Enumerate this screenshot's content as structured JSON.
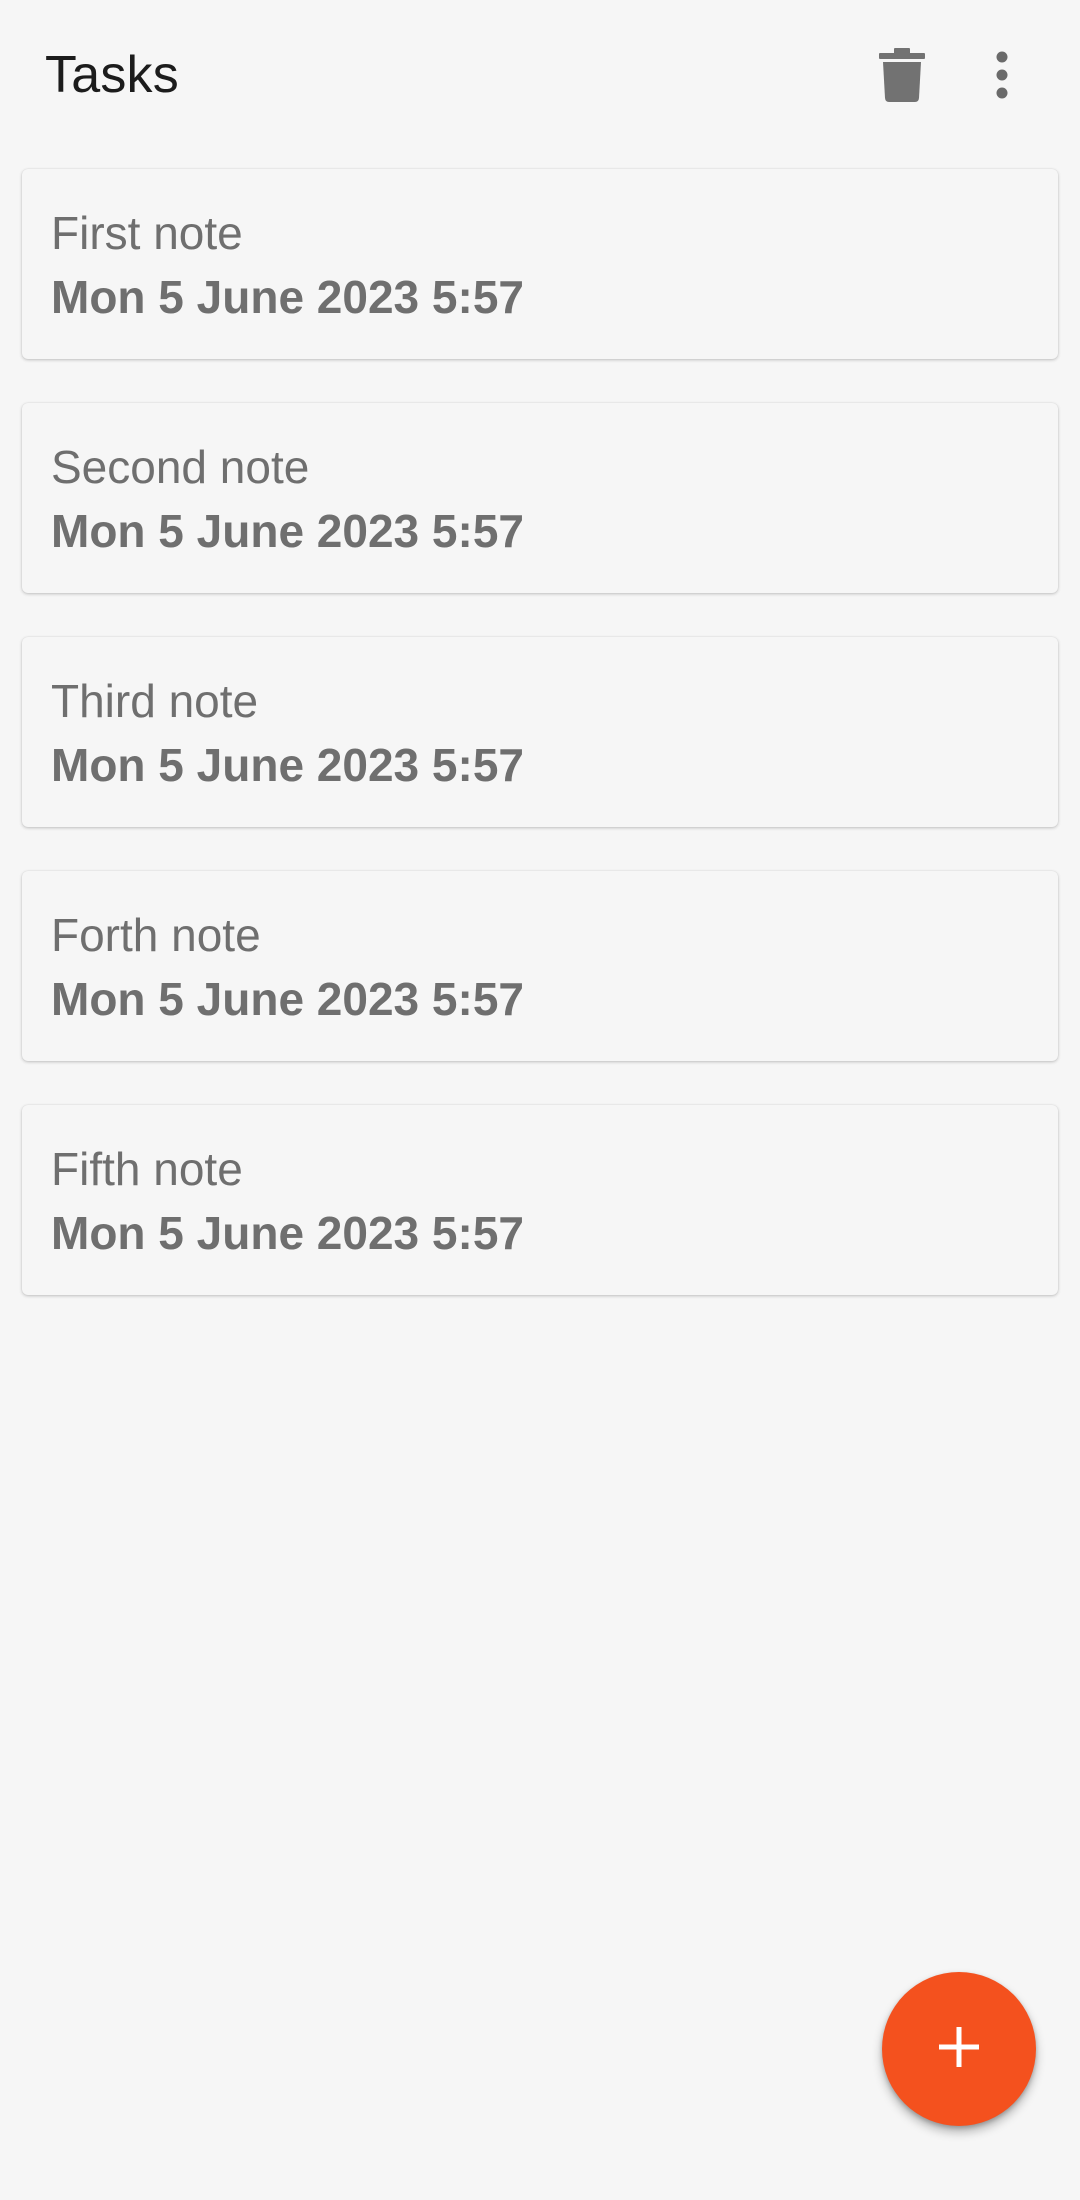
{
  "toolbar": {
    "title": "Tasks",
    "delete_icon": "trash-icon",
    "overflow_icon": "more-vert-icon"
  },
  "notes": [
    {
      "title": "First note",
      "date": "Mon 5 June 2023 5:57"
    },
    {
      "title": "Second note",
      "date": "Mon 5 June 2023 5:57"
    },
    {
      "title": "Third note",
      "date": "Mon 5 June 2023 5:57"
    },
    {
      "title": "Forth note",
      "date": "Mon 5 June 2023 5:57"
    },
    {
      "title": "Fifth note",
      "date": "Mon 5 June 2023 5:57"
    }
  ],
  "fab": {
    "icon": "plus-icon"
  },
  "colors": {
    "accent": "#f4511e",
    "background": "#f6f6f6",
    "text_secondary": "#6f6f6f",
    "title_text": "#1c1c1c"
  }
}
